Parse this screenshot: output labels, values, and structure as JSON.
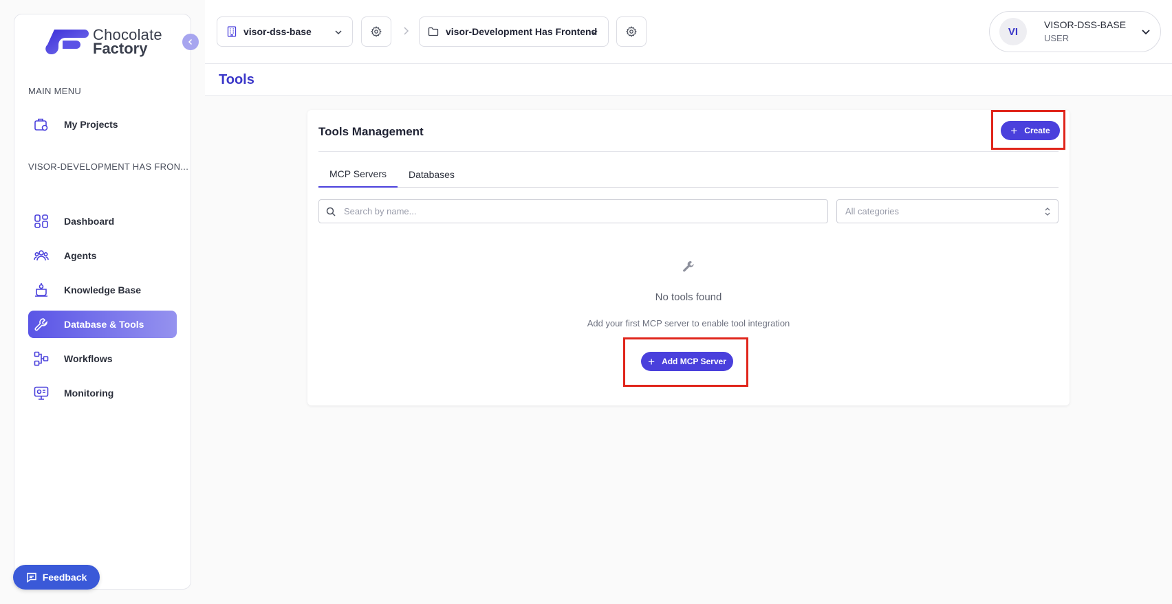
{
  "brand": {
    "line1": "Chocolate",
    "line2": "Factory"
  },
  "sidebar": {
    "main_menu_title": "MAIN MENU",
    "project_section_title": "VISOR-DEVELOPMENT HAS FRON...",
    "items": [
      {
        "label": "My Projects",
        "icon": "projects-icon"
      },
      {
        "label": "Dashboard",
        "icon": "dashboard-icon"
      },
      {
        "label": "Agents",
        "icon": "agents-icon"
      },
      {
        "label": "Knowledge Base",
        "icon": "knowledge-base-icon"
      },
      {
        "label": "Database & Tools",
        "icon": "wrench-icon",
        "active": true
      },
      {
        "label": "Workflows",
        "icon": "workflows-icon"
      },
      {
        "label": "Monitoring",
        "icon": "monitoring-icon"
      }
    ],
    "feedback_label": "Feedback"
  },
  "topbar": {
    "org_selector": "visor-dss-base",
    "project_selector": "visor-Development Has Frontend",
    "user": {
      "initials": "VI",
      "name": "VISOR-DSS-BASE",
      "role": "USER"
    }
  },
  "page": {
    "title": "Tools"
  },
  "card": {
    "title": "Tools Management",
    "create_label": "Create",
    "tabs": [
      {
        "label": "MCP Servers",
        "active": true
      },
      {
        "label": "Databases",
        "active": false
      }
    ],
    "search_placeholder": "Search by name...",
    "category_select": "All categories",
    "empty_title": "No tools found",
    "empty_subtitle": "Add your first MCP server to enable tool integration",
    "add_button_label": "Add MCP Server"
  },
  "colors": {
    "accent": "#4a40dc",
    "highlight_box": "#e0251b",
    "feedback": "#3a59d8"
  }
}
